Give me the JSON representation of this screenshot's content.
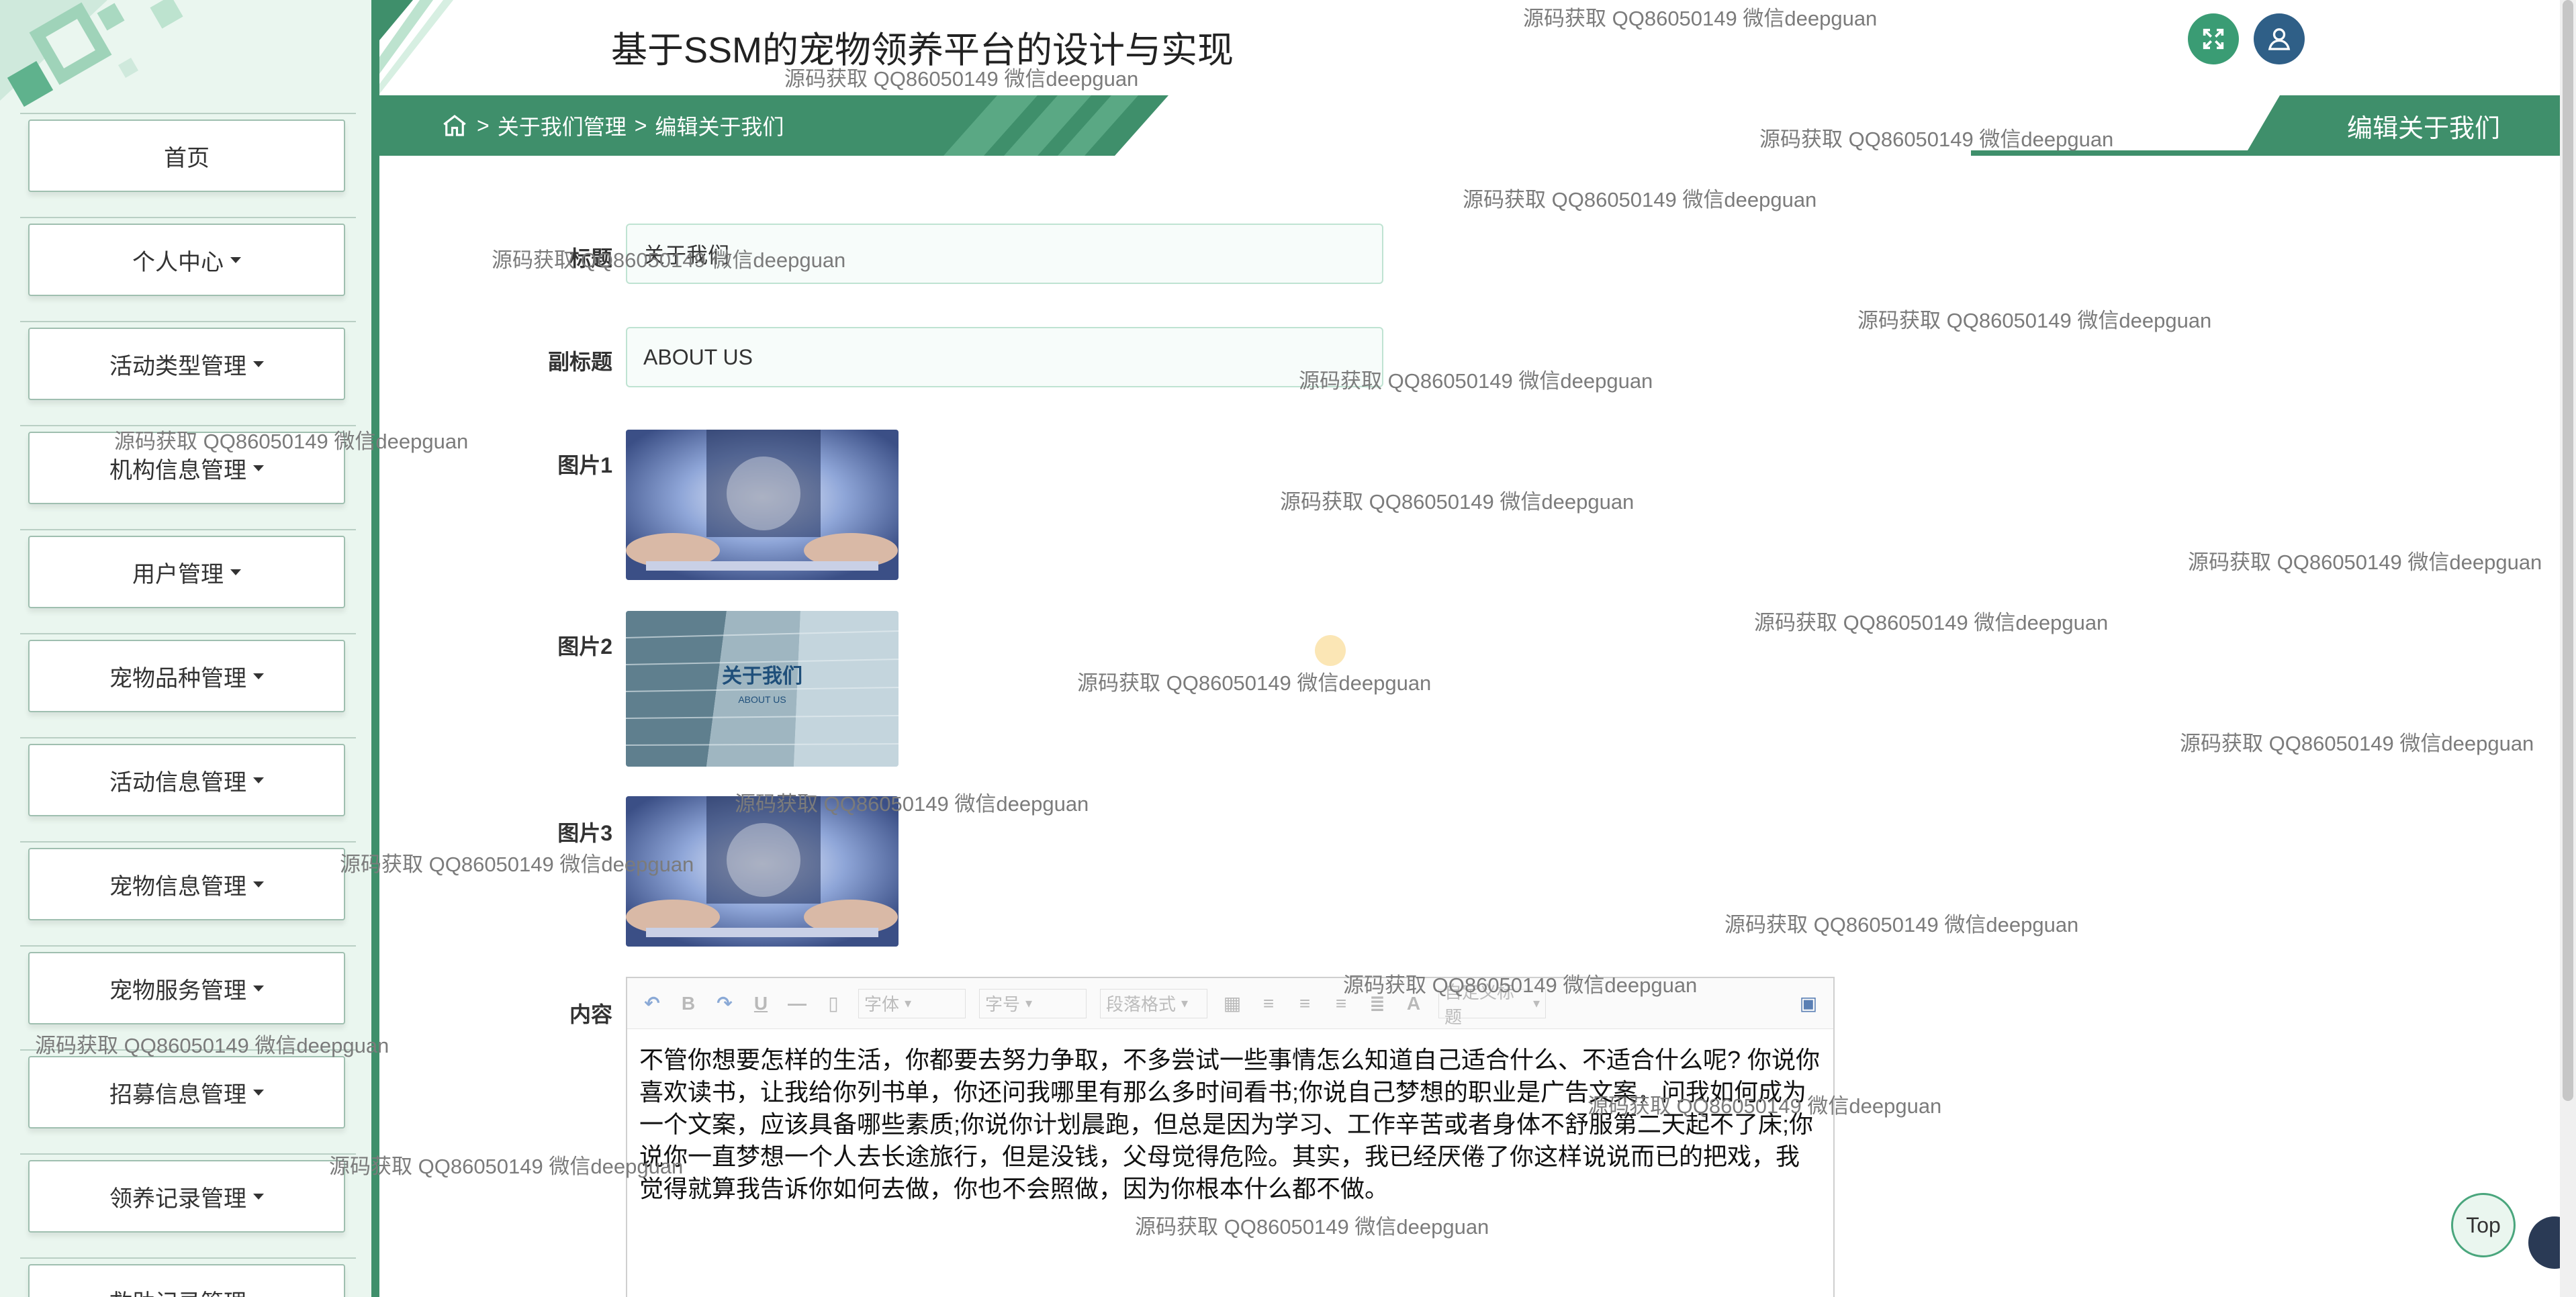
{
  "header": {
    "title": "基于SSM的宠物领养平台的设计与实现",
    "expand_icon": "fullscreen-icon",
    "user_icon": "user-icon"
  },
  "sidebar": {
    "items": [
      {
        "label": "首页",
        "has_caret": false
      },
      {
        "label": "个人中心",
        "has_caret": true
      },
      {
        "label": "活动类型管理",
        "has_caret": true
      },
      {
        "label": "机构信息管理",
        "has_caret": true
      },
      {
        "label": "用户管理",
        "has_caret": true
      },
      {
        "label": "宠物品种管理",
        "has_caret": true
      },
      {
        "label": "活动信息管理",
        "has_caret": true
      },
      {
        "label": "宠物信息管理",
        "has_caret": true
      },
      {
        "label": "宠物服务管理",
        "has_caret": true
      },
      {
        "label": "招募信息管理",
        "has_caret": true
      },
      {
        "label": "领养记录管理",
        "has_caret": true
      },
      {
        "label": "救助记录管理",
        "has_caret": true
      }
    ]
  },
  "breadcrumb": {
    "home_icon": "home-icon",
    "separator": ">",
    "level1": "关于我们管理",
    "level2": "编辑关于我们",
    "page_heading": "编辑关于我们"
  },
  "form": {
    "title_label": "标题",
    "title_value": "关于我们",
    "subtitle_label": "副标题",
    "subtitle_value": "ABOUT US",
    "image1_label": "图片1",
    "image2_label": "图片2",
    "image2_text_cn": "关于我们",
    "image2_text_en": "ABOUT US",
    "image3_label": "图片3",
    "content_label": "内容"
  },
  "editor": {
    "toolbar": {
      "font_family": "字体",
      "font_size": "字号",
      "paragraph": "段落格式",
      "custom_title": "自定义标题"
    },
    "content": "不管你想要怎样的生活，你都要去努力争取，不多尝试一些事情怎么知道自己适合什么、不适合什么呢? 你说你喜欢读书，让我给你列书单，你还问我哪里有那么多时间看书;你说自己梦想的职业是广告文案，问我如何成为一个文案，应该具备哪些素质;你说你计划晨跑，但总是因为学习、工作辛苦或者身体不舒服第二天起不了床;你说你一直梦想一个人去长途旅行，但是没钱，父母觉得危险。其实，我已经厌倦了你这样说说而已的把戏，我觉得就算我告诉你如何去做，你也不会照做，因为你根本什么都不做。"
  },
  "watermark": "源码获取 QQ86050149 微信deepguan",
  "top_button": "Top",
  "colors": {
    "primary": "#3f8f6b",
    "sidebar_bg": "#eaf6ef",
    "user_btn": "#2f5f87",
    "expand_btn": "#3a9c74"
  }
}
